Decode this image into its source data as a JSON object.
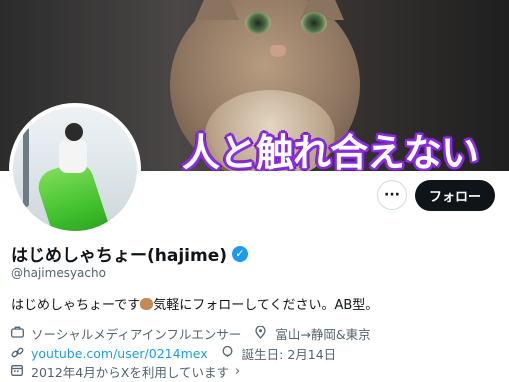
{
  "banner": {
    "caption": "人と触れ合えない"
  },
  "actions": {
    "more_label": "···",
    "follow_label": "フォロー"
  },
  "profile": {
    "display_name": "はじめしゃちょー(hajime)",
    "handle": "@hajimesyacho",
    "bio_before": "はじめしゃちょーです",
    "bio_after": "気軽にフォローしてください。AB型。",
    "category": "ソーシャルメディアインフルエンサー",
    "location": "富山→静岡&東京",
    "website": "youtube.com/user/0214mex",
    "birthday": "誕生日: 2月14日",
    "joined": "2012年4月からXを利用しています"
  },
  "icons": {
    "verified": "verified-badge-icon",
    "category": "briefcase-icon",
    "location": "location-pin-icon",
    "website": "link-icon",
    "birthday": "balloon-icon",
    "joined": "calendar-icon",
    "chevron": "chevron-right-icon"
  },
  "colors": {
    "accent": "#1d9bf0",
    "text": "#0f1419",
    "muted": "#536471",
    "caption_outline": "#8a2be2"
  }
}
